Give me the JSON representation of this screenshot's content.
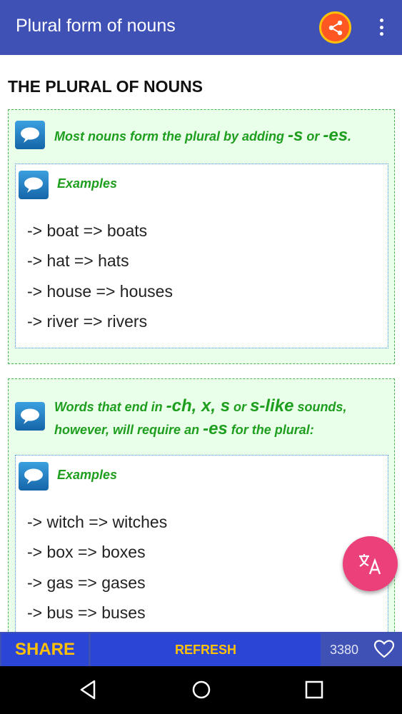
{
  "app_bar": {
    "title": "Plural form of nouns",
    "share_icon": "share-icon",
    "overflow_icon": "more-vert-icon"
  },
  "page": {
    "heading": "THE PLURAL OF NOUNS"
  },
  "cards": [
    {
      "rule_parts": [
        "Most nouns form the plural by adding ",
        "-s",
        " or ",
        "-es",
        "."
      ],
      "examples_label": "Examples",
      "examples": [
        "-> boat => boats",
        "-> hat => hats",
        "-> house => houses",
        "-> river => rivers"
      ]
    },
    {
      "rule_line1_parts": [
        "Words that end in ",
        "-ch, x, s",
        " or ",
        "s-like",
        " sounds,"
      ],
      "rule_line2_parts": [
        "however, will require an ",
        "-es",
        " for the plural:"
      ],
      "examples_label": "Examples",
      "examples": [
        "-> witch => witches",
        "-> box => boxes",
        "-> gas => gases",
        "-> bus => buses"
      ]
    }
  ],
  "fab": {
    "icon": "translate-icon"
  },
  "bottom_bar": {
    "share_label": "SHARE",
    "refresh_label": "REFRESH",
    "likes_count": "3380",
    "heart_icon": "heart-outline-icon"
  },
  "nav": {
    "back_icon": "back-icon",
    "home_icon": "home-icon",
    "recents_icon": "recents-icon"
  },
  "colors": {
    "primary": "#3f51b5",
    "accent_yellow": "#ffc107",
    "rule_green": "#1e9e1e",
    "fab_pink": "#ec407a",
    "card_bg": "#eaffea"
  }
}
